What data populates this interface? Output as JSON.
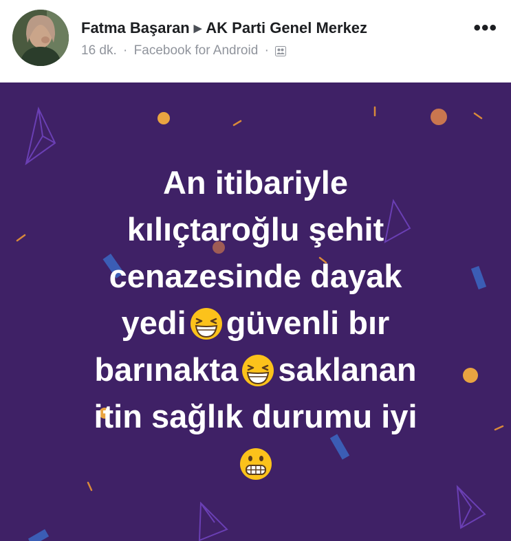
{
  "post": {
    "author": "Fatma Başaran",
    "target": "AK Parti Genel Merkez",
    "time": "16 dk.",
    "separator": "·",
    "app": "Facebook for Android",
    "more_label": "•••"
  },
  "icons": {
    "avatar": "profile-photo",
    "arrow": "right-triangle-icon",
    "audience": "friends-audience-icon",
    "emoji_laugh": "grinning-squinting-face",
    "emoji_grimace": "grimacing-face"
  },
  "colors": {
    "background_card": "#3f2166",
    "text": "#ffffff",
    "name": "#1c1e21",
    "meta": "#90949c"
  },
  "text_post": {
    "line1": "An itibariyle",
    "line2": "kılıçtaroğlu şehit",
    "line3": "cenazesinde dayak",
    "line4a": "yedi",
    "line4b": "güvenli bır",
    "line5a": "barınakta",
    "line5b": "saklanan",
    "line6": "itin sağlık durumu iyi"
  }
}
